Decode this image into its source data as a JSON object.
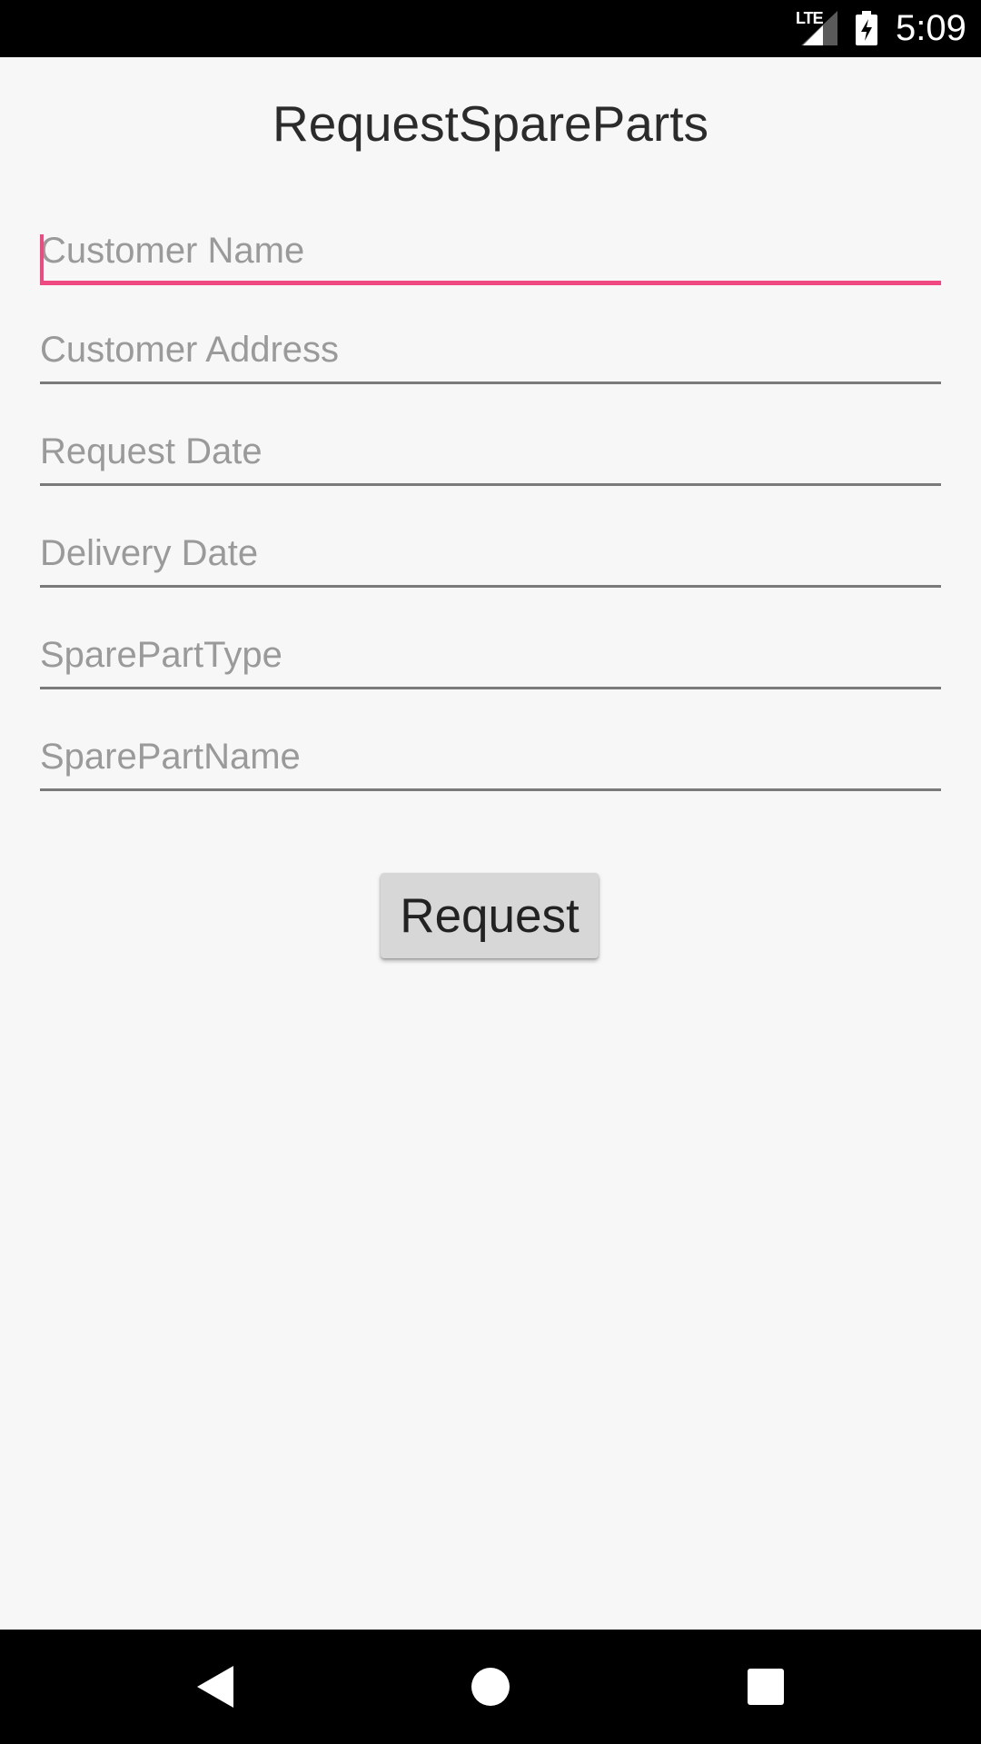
{
  "status_bar": {
    "network": "LTE",
    "time": "5:09",
    "icons": [
      "lte-icon",
      "signal-icon",
      "battery-charging-icon"
    ]
  },
  "page": {
    "title": "RequestSpareParts"
  },
  "form": {
    "fields": [
      {
        "placeholder": "Customer Name",
        "value": "",
        "focused": true
      },
      {
        "placeholder": "Customer Address",
        "value": ""
      },
      {
        "placeholder": "Request Date",
        "value": ""
      },
      {
        "placeholder": "Delivery Date",
        "value": ""
      },
      {
        "placeholder": "SparePartType",
        "value": ""
      },
      {
        "placeholder": "SparePartName",
        "value": ""
      }
    ],
    "submit_label": "Request"
  },
  "nav_bar": {
    "icons": [
      "back-icon",
      "home-icon",
      "recents-icon"
    ]
  },
  "colors": {
    "accent": "#f04982",
    "background": "#f7f7f7",
    "button": "#d7d7d7",
    "bars": "#000000"
  }
}
